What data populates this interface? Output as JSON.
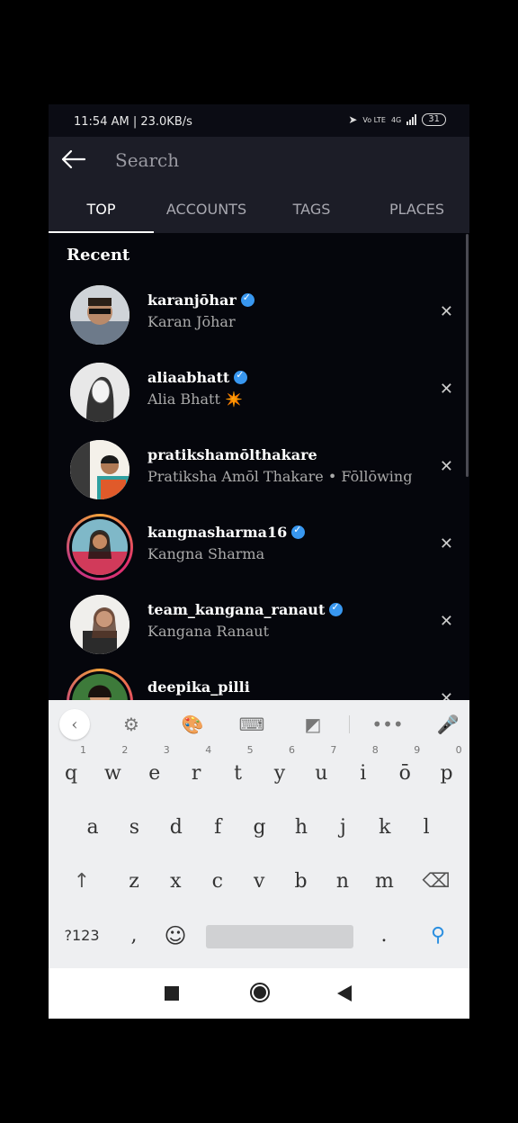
{
  "status_bar": {
    "time": "11:54 AM | 23.0KB/s",
    "network": "4G",
    "volte": "Vo LTE",
    "battery": "31"
  },
  "search": {
    "placeholder": "Search"
  },
  "tabs": [
    {
      "label": "TOP",
      "active": true
    },
    {
      "label": "ACCOUNTS",
      "active": false
    },
    {
      "label": "TAGS",
      "active": false
    },
    {
      "label": "PLACES",
      "active": false
    }
  ],
  "recent": {
    "title": "Recent",
    "items": [
      {
        "username": "karanjōhar",
        "fullname": "Karan Jōhar",
        "verified": true,
        "story_ring": false
      },
      {
        "username": "aliaabhatt",
        "fullname": "Alia Bhatt ✴️",
        "verified": true,
        "story_ring": false
      },
      {
        "username": "pratikshamōlthakare",
        "fullname": "Pratiksha Amōl Thakare • Fōllōwing",
        "verified": false,
        "story_ring": false
      },
      {
        "username": "kangnasharma16",
        "fullname": "Kangna Sharma",
        "verified": true,
        "story_ring": true
      },
      {
        "username": "team_kangana_ranaut",
        "fullname": "Kangana Ranaut",
        "verified": true,
        "story_ring": false
      },
      {
        "username": "deepika_pilli",
        "fullname": "",
        "verified": false,
        "story_ring": true
      }
    ]
  },
  "keyboard": {
    "row1": [
      {
        "k": "q",
        "n": "1"
      },
      {
        "k": "w",
        "n": "2"
      },
      {
        "k": "e",
        "n": "3"
      },
      {
        "k": "r",
        "n": "4"
      },
      {
        "k": "t",
        "n": "5"
      },
      {
        "k": "y",
        "n": "6"
      },
      {
        "k": "u",
        "n": "7"
      },
      {
        "k": "i",
        "n": "8"
      },
      {
        "k": "ō",
        "n": "9"
      },
      {
        "k": "p",
        "n": "0"
      }
    ],
    "row2": [
      "a",
      "s",
      "d",
      "f",
      "g",
      "h",
      "j",
      "k",
      "l"
    ],
    "row3": [
      "z",
      "x",
      "c",
      "v",
      "b",
      "n",
      "m"
    ],
    "symbols_label": "?123",
    "comma": ",",
    "period": "."
  },
  "colors": {
    "accent": "#3897f0",
    "background": "#05060c",
    "header": "#1c1d27",
    "keyboard": "#eeeff1"
  }
}
